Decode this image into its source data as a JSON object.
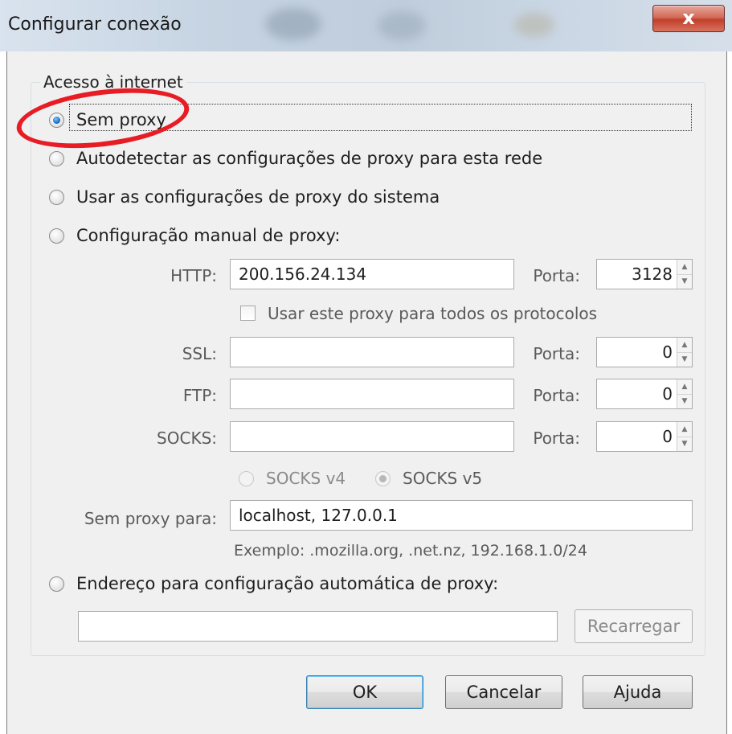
{
  "window": {
    "title": "Configurar conexão",
    "close_label": "x"
  },
  "group": {
    "legend": "Acesso à internet"
  },
  "options": {
    "no_proxy": "Sem proxy",
    "auto_detect": "Autodetectar as configurações de proxy para esta rede",
    "system": "Usar as configurações de proxy do sistema",
    "manual": "Configuração manual de proxy:",
    "pac": "Endereço para configuração automática de proxy:",
    "selected": "no_proxy"
  },
  "manual": {
    "http_label": "HTTP:",
    "http_value": "200.156.24.134",
    "http_port_label": "Porta:",
    "http_port_value": "3128",
    "use_all_label": "Usar este proxy para todos os protocolos",
    "ssl_label": "SSL:",
    "ssl_value": "",
    "ssl_port_label": "Porta:",
    "ssl_port_value": "0",
    "ftp_label": "FTP:",
    "ftp_value": "",
    "ftp_port_label": "Porta:",
    "ftp_port_value": "0",
    "socks_label": "SOCKS:",
    "socks_value": "",
    "socks_port_label": "Porta:",
    "socks_port_value": "0",
    "socks_v4": "SOCKS v4",
    "socks_v5": "SOCKS v5",
    "no_proxy_for_label": "Sem proxy para:",
    "no_proxy_for_value": "localhost, 127.0.0.1",
    "example": "Exemplo: .mozilla.org, .net.nz, 192.168.1.0/24"
  },
  "pac": {
    "url_value": "",
    "reload_label": "Recarregar"
  },
  "buttons": {
    "ok": "OK",
    "cancel": "Cancelar",
    "help": "Ajuda"
  },
  "colors": {
    "annotation_circle": "#e81c24",
    "close_button": "#c2402c"
  }
}
